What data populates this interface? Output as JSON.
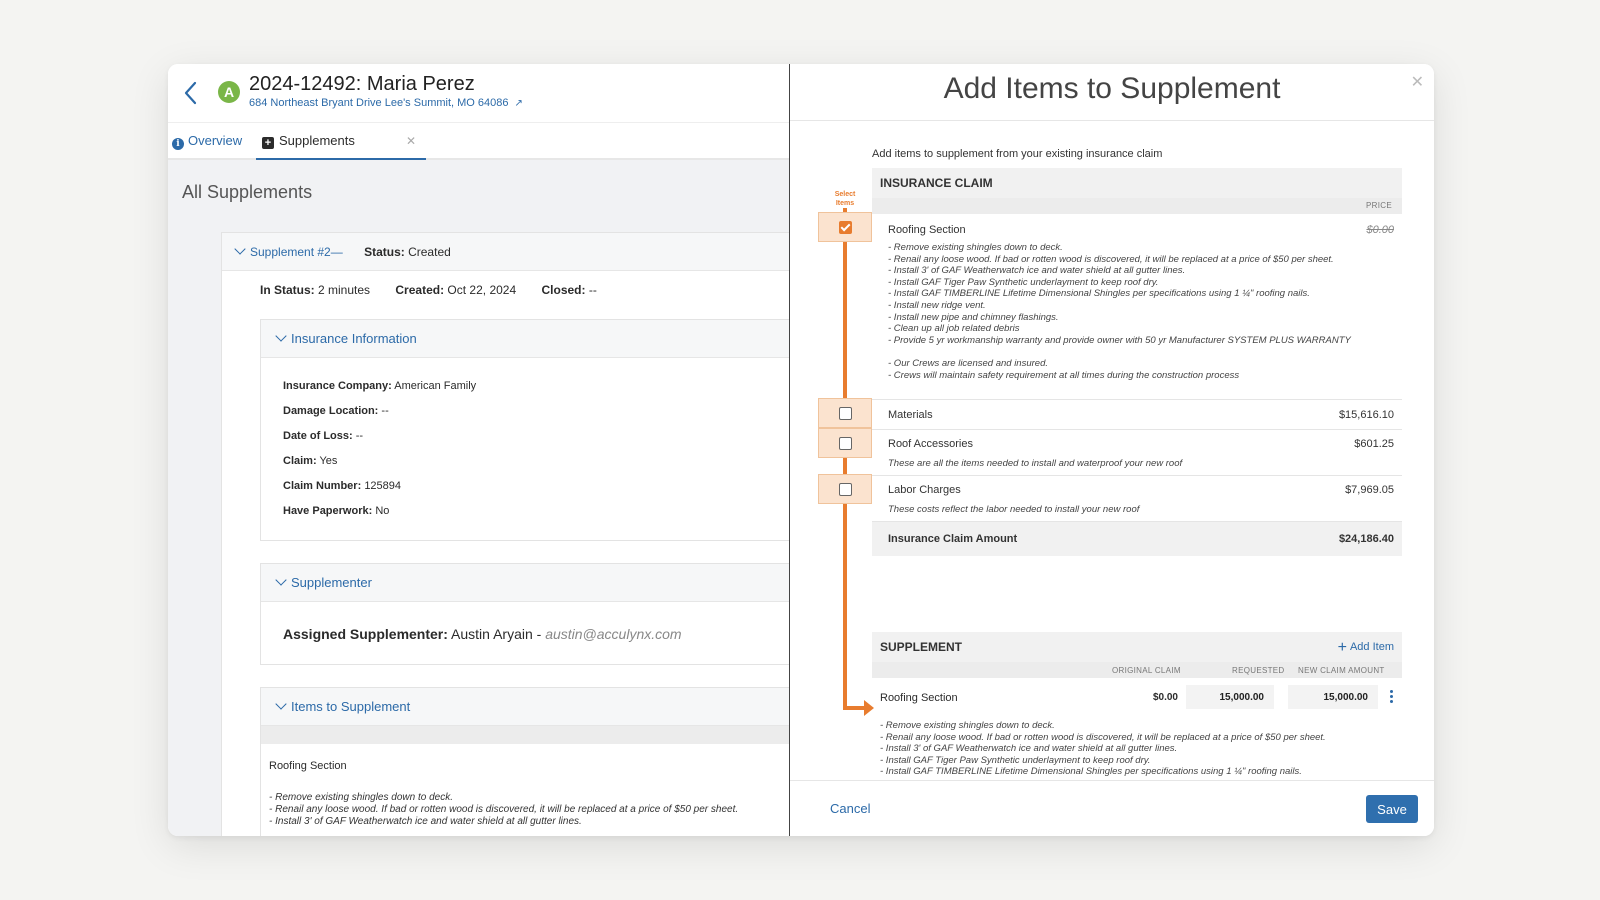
{
  "job": {
    "avatar_letter": "A",
    "title": "2024-12492: Maria Perez",
    "address": "684 Northeast Bryant Drive Lee's Summit, MO 64086"
  },
  "tabs": [
    {
      "label": "Overview",
      "icon": "info-icon"
    },
    {
      "label": "Supplements",
      "icon": "plus-square-icon"
    }
  ],
  "left": {
    "section_title": "All Supplements",
    "supplement": {
      "label": "Supplement #2—",
      "status_label": "Status:",
      "status_value": "Created",
      "in_status_label": "In Status:",
      "in_status_value": "2 minutes",
      "created_label": "Created:",
      "created_value": "Oct 22, 2024",
      "closed_label": "Closed:",
      "closed_value": "--"
    },
    "insurance": {
      "header": "Insurance Information",
      "fields": [
        {
          "label": "Insurance Company:",
          "value": "American Family"
        },
        {
          "label": "Damage Location:",
          "value": "--"
        },
        {
          "label": "Date of Loss:",
          "value": "--"
        },
        {
          "label": "Claim:",
          "value": "Yes"
        },
        {
          "label": "Claim Number:",
          "value": "125894"
        },
        {
          "label": "Have Paperwork:",
          "value": "No"
        }
      ]
    },
    "supplementer": {
      "header": "Supplementer",
      "label": "Assigned Supplementer:",
      "name": "Austin Aryain -",
      "email": "austin@acculynx.com"
    },
    "items": {
      "header": "Items to Supplement",
      "row_name": "Roofing Section",
      "desc_lines": [
        "- Remove existing shingles down to deck.",
        "- Renail any loose wood. If bad or rotten wood is discovered, it will be replaced at a price of $50 per sheet.",
        "- Install 3' of GAF Weatherwatch ice and water shield at all gutter lines."
      ]
    }
  },
  "modal": {
    "title": "Add Items to Supplement",
    "intro": "Add items to supplement from your existing insurance claim",
    "select_hint": "Select Items",
    "claim": {
      "header": "INSURANCE CLAIM",
      "price_col": "PRICE",
      "items": [
        {
          "name": "Roofing Section",
          "price": "$0.00",
          "checked": true,
          "desc_lines": [
            "-  Remove existing shingles down to deck.",
            "-  Renail any loose wood.  If bad or rotten wood is discovered, it will be replaced at a price of $50 per sheet.",
            "-  Install 3' of GAF Weatherwatch ice and water shield at all gutter lines.",
            "-  Install GAF Tiger Paw Synthetic underlayment to keep roof dry.",
            "-  Install GAF TIMBERLINE Lifetime Dimensional Shingles  per specifications using 1 ¼\" roofing nails.",
            "-  Install new ridge vent.",
            "-  Install new pipe and chimney flashings.",
            "-  Clean up all job related debris",
            "-  Provide 5 yr workmanship warranty and provide owner with 50 yr Manufacturer SYSTEM PLUS WARRANTY",
            "",
            "-  Our Crews are licensed and insured.",
            "- Crews will maintain safety requirement at all times during the construction process"
          ]
        },
        {
          "name": "Materials",
          "price": "$15,616.10",
          "checked": false,
          "desc": ""
        },
        {
          "name": "Roof Accessories",
          "price": "$601.25",
          "checked": false,
          "desc": "These are all the items needed to install and waterproof your new roof"
        },
        {
          "name": "Labor Charges",
          "price": "$7,969.05",
          "checked": false,
          "desc": "These costs reflect the labor needed to install your new roof"
        }
      ],
      "total_label": "Insurance Claim Amount",
      "total_value": "$24,186.40"
    },
    "supplement": {
      "header": "SUPPLEMENT",
      "add_item": "Add Item",
      "col_original": "ORIGINAL CLAIM",
      "col_requested": "REQUESTED",
      "col_new": "NEW CLAIM AMOUNT",
      "row": {
        "name": "Roofing Section",
        "original": "$0.00",
        "requested": "15,000.00",
        "new_amount": "15,000.00"
      },
      "desc_lines": [
        "- Remove existing shingles down to deck.",
        "- Renail any loose wood. If bad or rotten wood is discovered, it will be replaced at a price of $50 per sheet.",
        "- Install 3' of GAF Weatherwatch ice and water shield at all gutter lines.",
        "- Install GAF Tiger Paw Synthetic underlayment to keep roof dry.",
        "- Install GAF TIMBERLINE Lifetime Dimensional Shingles per specifications using 1 ¼\" roofing nails."
      ]
    },
    "footer": {
      "cancel": "Cancel",
      "save": "Save"
    }
  },
  "colors": {
    "accent": "#2c6aa8",
    "highlight": "#e87c2e",
    "avatar": "#7ab648",
    "save": "#2f6fae"
  }
}
